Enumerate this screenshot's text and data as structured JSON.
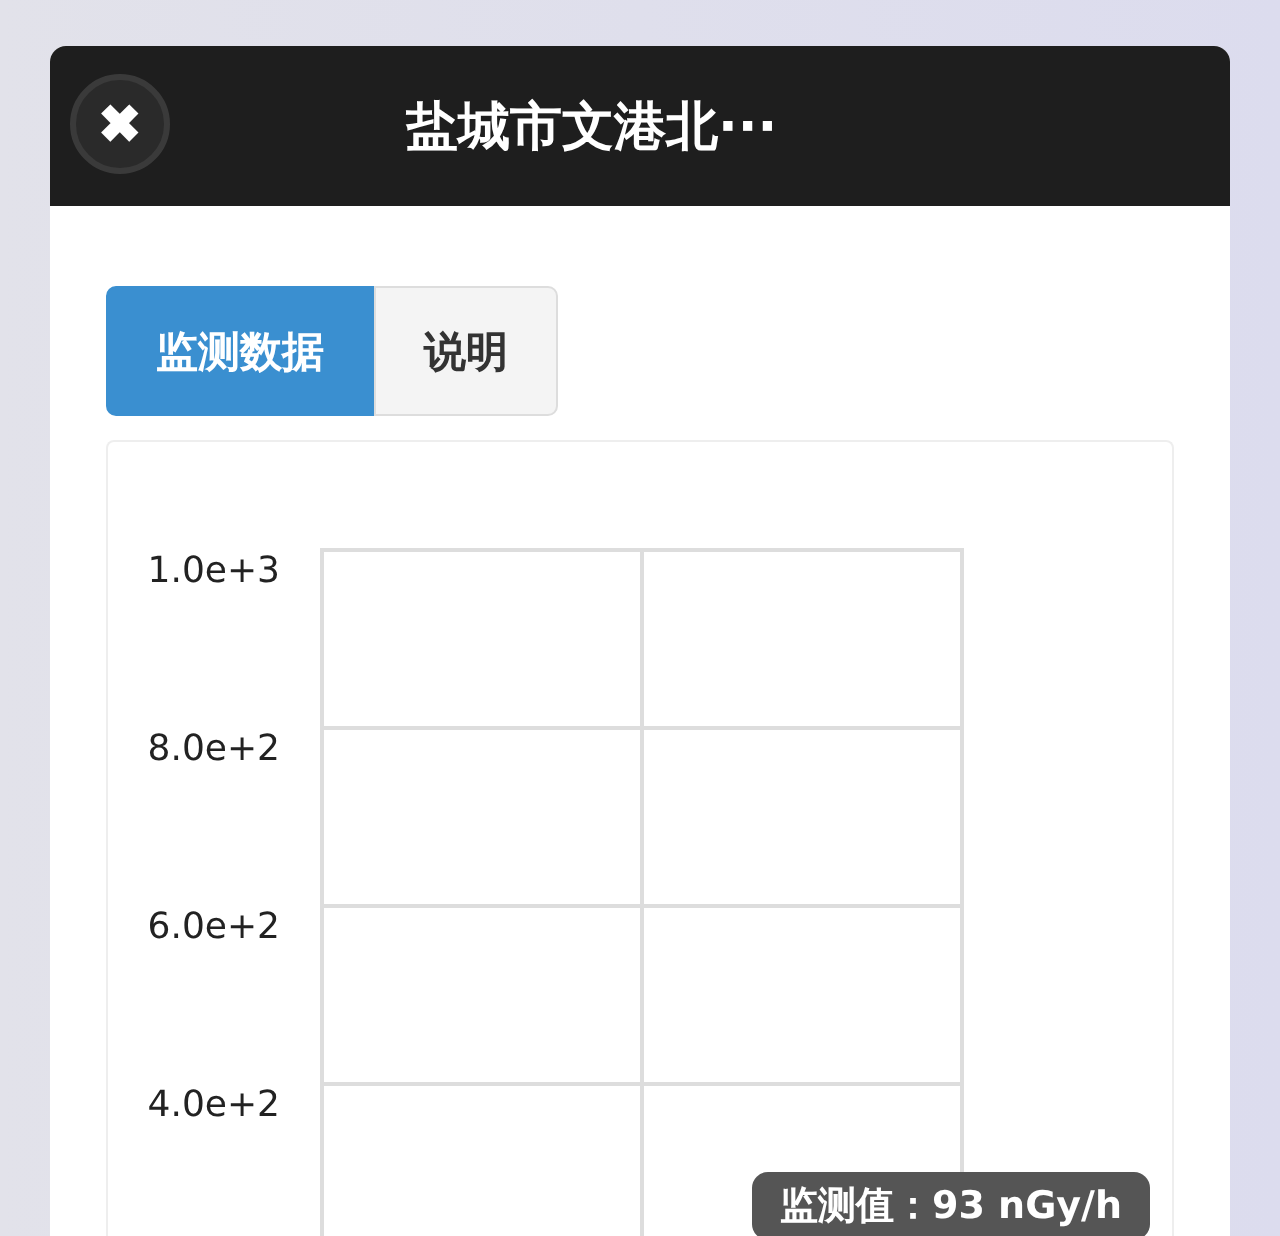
{
  "dialog": {
    "title": "盐城市文港北···",
    "close_icon": "✖"
  },
  "tabs": [
    {
      "label": "监测数据",
      "selected": true
    },
    {
      "label": "说明",
      "selected": false
    }
  ],
  "chart": {
    "y_ticks": [
      "1.0e+3",
      "8.0e+2",
      "6.0e+2",
      "4.0e+2"
    ],
    "tooltip": {
      "label": "监测值：",
      "value": "93 nGy/h"
    }
  }
}
